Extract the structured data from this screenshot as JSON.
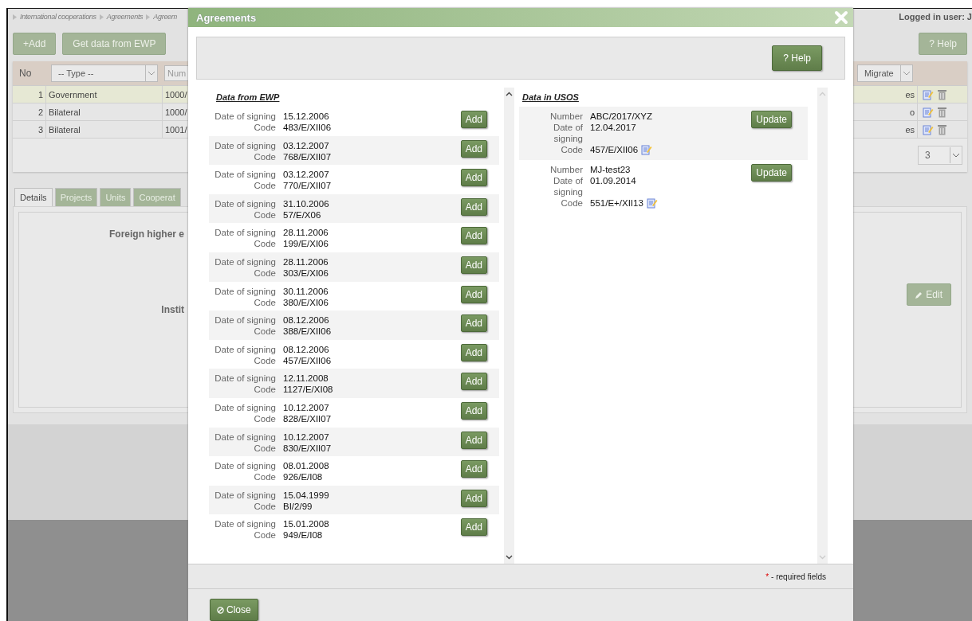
{
  "breadcrumb": [
    "International cooperations",
    "Agreements",
    "Agreem"
  ],
  "user_label": "Logged in user: J",
  "toolbar_buttons": [
    {
      "label": "+Add"
    },
    {
      "label": "Get data from EWP"
    }
  ],
  "help_button": "? Help",
  "table": {
    "header_no": "No",
    "type_filter": "-- Type --",
    "number_placeholder": "Num",
    "migrate_filter": "Migrate",
    "rows": [
      {
        "no": "1",
        "type": "Government",
        "number": "1000/",
        "col_4": "es",
        "selected": true
      },
      {
        "no": "2",
        "type": "Bilateral",
        "number": "1000/",
        "col_4": "o",
        "selected": false
      },
      {
        "no": "3",
        "type": "Bilateral",
        "number": "1001/",
        "col_4": "es",
        "selected": false
      }
    ],
    "page_size": "3"
  },
  "tabs": [
    {
      "label": "Details",
      "selected": true
    },
    {
      "label": "Projects",
      "selected": false
    },
    {
      "label": "Units",
      "selected": false
    },
    {
      "label": "Cooperat",
      "selected": false
    }
  ],
  "detail_labels": [
    "Foreign higher e",
    "Instit"
  ],
  "edit_button": "Edit",
  "dialog": {
    "title": "Agreements",
    "help_button": "? Help",
    "ewp": {
      "heading": "Data from EWP",
      "items": [
        {
          "date_label": "Date of signing",
          "date": "15.12.2006",
          "code_label": "Code",
          "code": "483/E/XII06",
          "button": "Add"
        },
        {
          "date_label": "Date of signing",
          "date": "03.12.2007",
          "code_label": "Code",
          "code": "768/E/XII07",
          "button": "Add"
        },
        {
          "date_label": "Date of signing",
          "date": "03.12.2007",
          "code_label": "Code",
          "code": "770/E/XII07",
          "button": "Add"
        },
        {
          "date_label": "Date of signing",
          "date": "31.10.2006",
          "code_label": "Code",
          "code": "57/E/X06",
          "button": "Add"
        },
        {
          "date_label": "Date of signing",
          "date": "28.11.2006",
          "code_label": "Code",
          "code": "199/E/XI06",
          "button": "Add"
        },
        {
          "date_label": "Date of signing",
          "date": "28.11.2006",
          "code_label": "Code",
          "code": "303/E/XI06",
          "button": "Add"
        },
        {
          "date_label": "Date of signing",
          "date": "30.11.2006",
          "code_label": "Code",
          "code": "380/E/XI06",
          "button": "Add"
        },
        {
          "date_label": "Date of signing",
          "date": "08.12.2006",
          "code_label": "Code",
          "code": "388/E/XII06",
          "button": "Add"
        },
        {
          "date_label": "Date of signing",
          "date": "08.12.2006",
          "code_label": "Code",
          "code": "457/E/XII06",
          "button": "Add"
        },
        {
          "date_label": "Date of signing",
          "date": "12.11.2008",
          "code_label": "Code",
          "code": "1127/E/XI08",
          "button": "Add"
        },
        {
          "date_label": "Date of signing",
          "date": "10.12.2007",
          "code_label": "Code",
          "code": "828/E/XII07",
          "button": "Add"
        },
        {
          "date_label": "Date of signing",
          "date": "10.12.2007",
          "code_label": "Code",
          "code": "830/E/XII07",
          "button": "Add"
        },
        {
          "date_label": "Date of signing",
          "date": "08.01.2008",
          "code_label": "Code",
          "code": "926/E/I08",
          "button": "Add"
        },
        {
          "date_label": "Date of signing",
          "date": "15.04.1999",
          "code_label": "Code",
          "code": "BI/2/99",
          "button": "Add"
        },
        {
          "date_label": "Date of signing",
          "date": "15.01.2008",
          "code_label": "Code",
          "code": "949/E/I08",
          "button": "Add"
        }
      ]
    },
    "usos": {
      "heading": "Data in USOS",
      "items": [
        {
          "number_label": "Number",
          "number": "ABC/2017/XYZ",
          "date_label": "Date of signing",
          "date": "12.04.2017",
          "code_label": "Code",
          "code": "457/E/XII06",
          "button": "Update"
        },
        {
          "number_label": "Number",
          "number": "MJ-test23",
          "date_label": "Date of signing",
          "date": "01.09.2014",
          "code_label": "Code",
          "code": "551/E+/XII13",
          "button": "Update"
        }
      ]
    },
    "required_mark": "*",
    "required_text": "- required fields",
    "close_button": "Close"
  }
}
